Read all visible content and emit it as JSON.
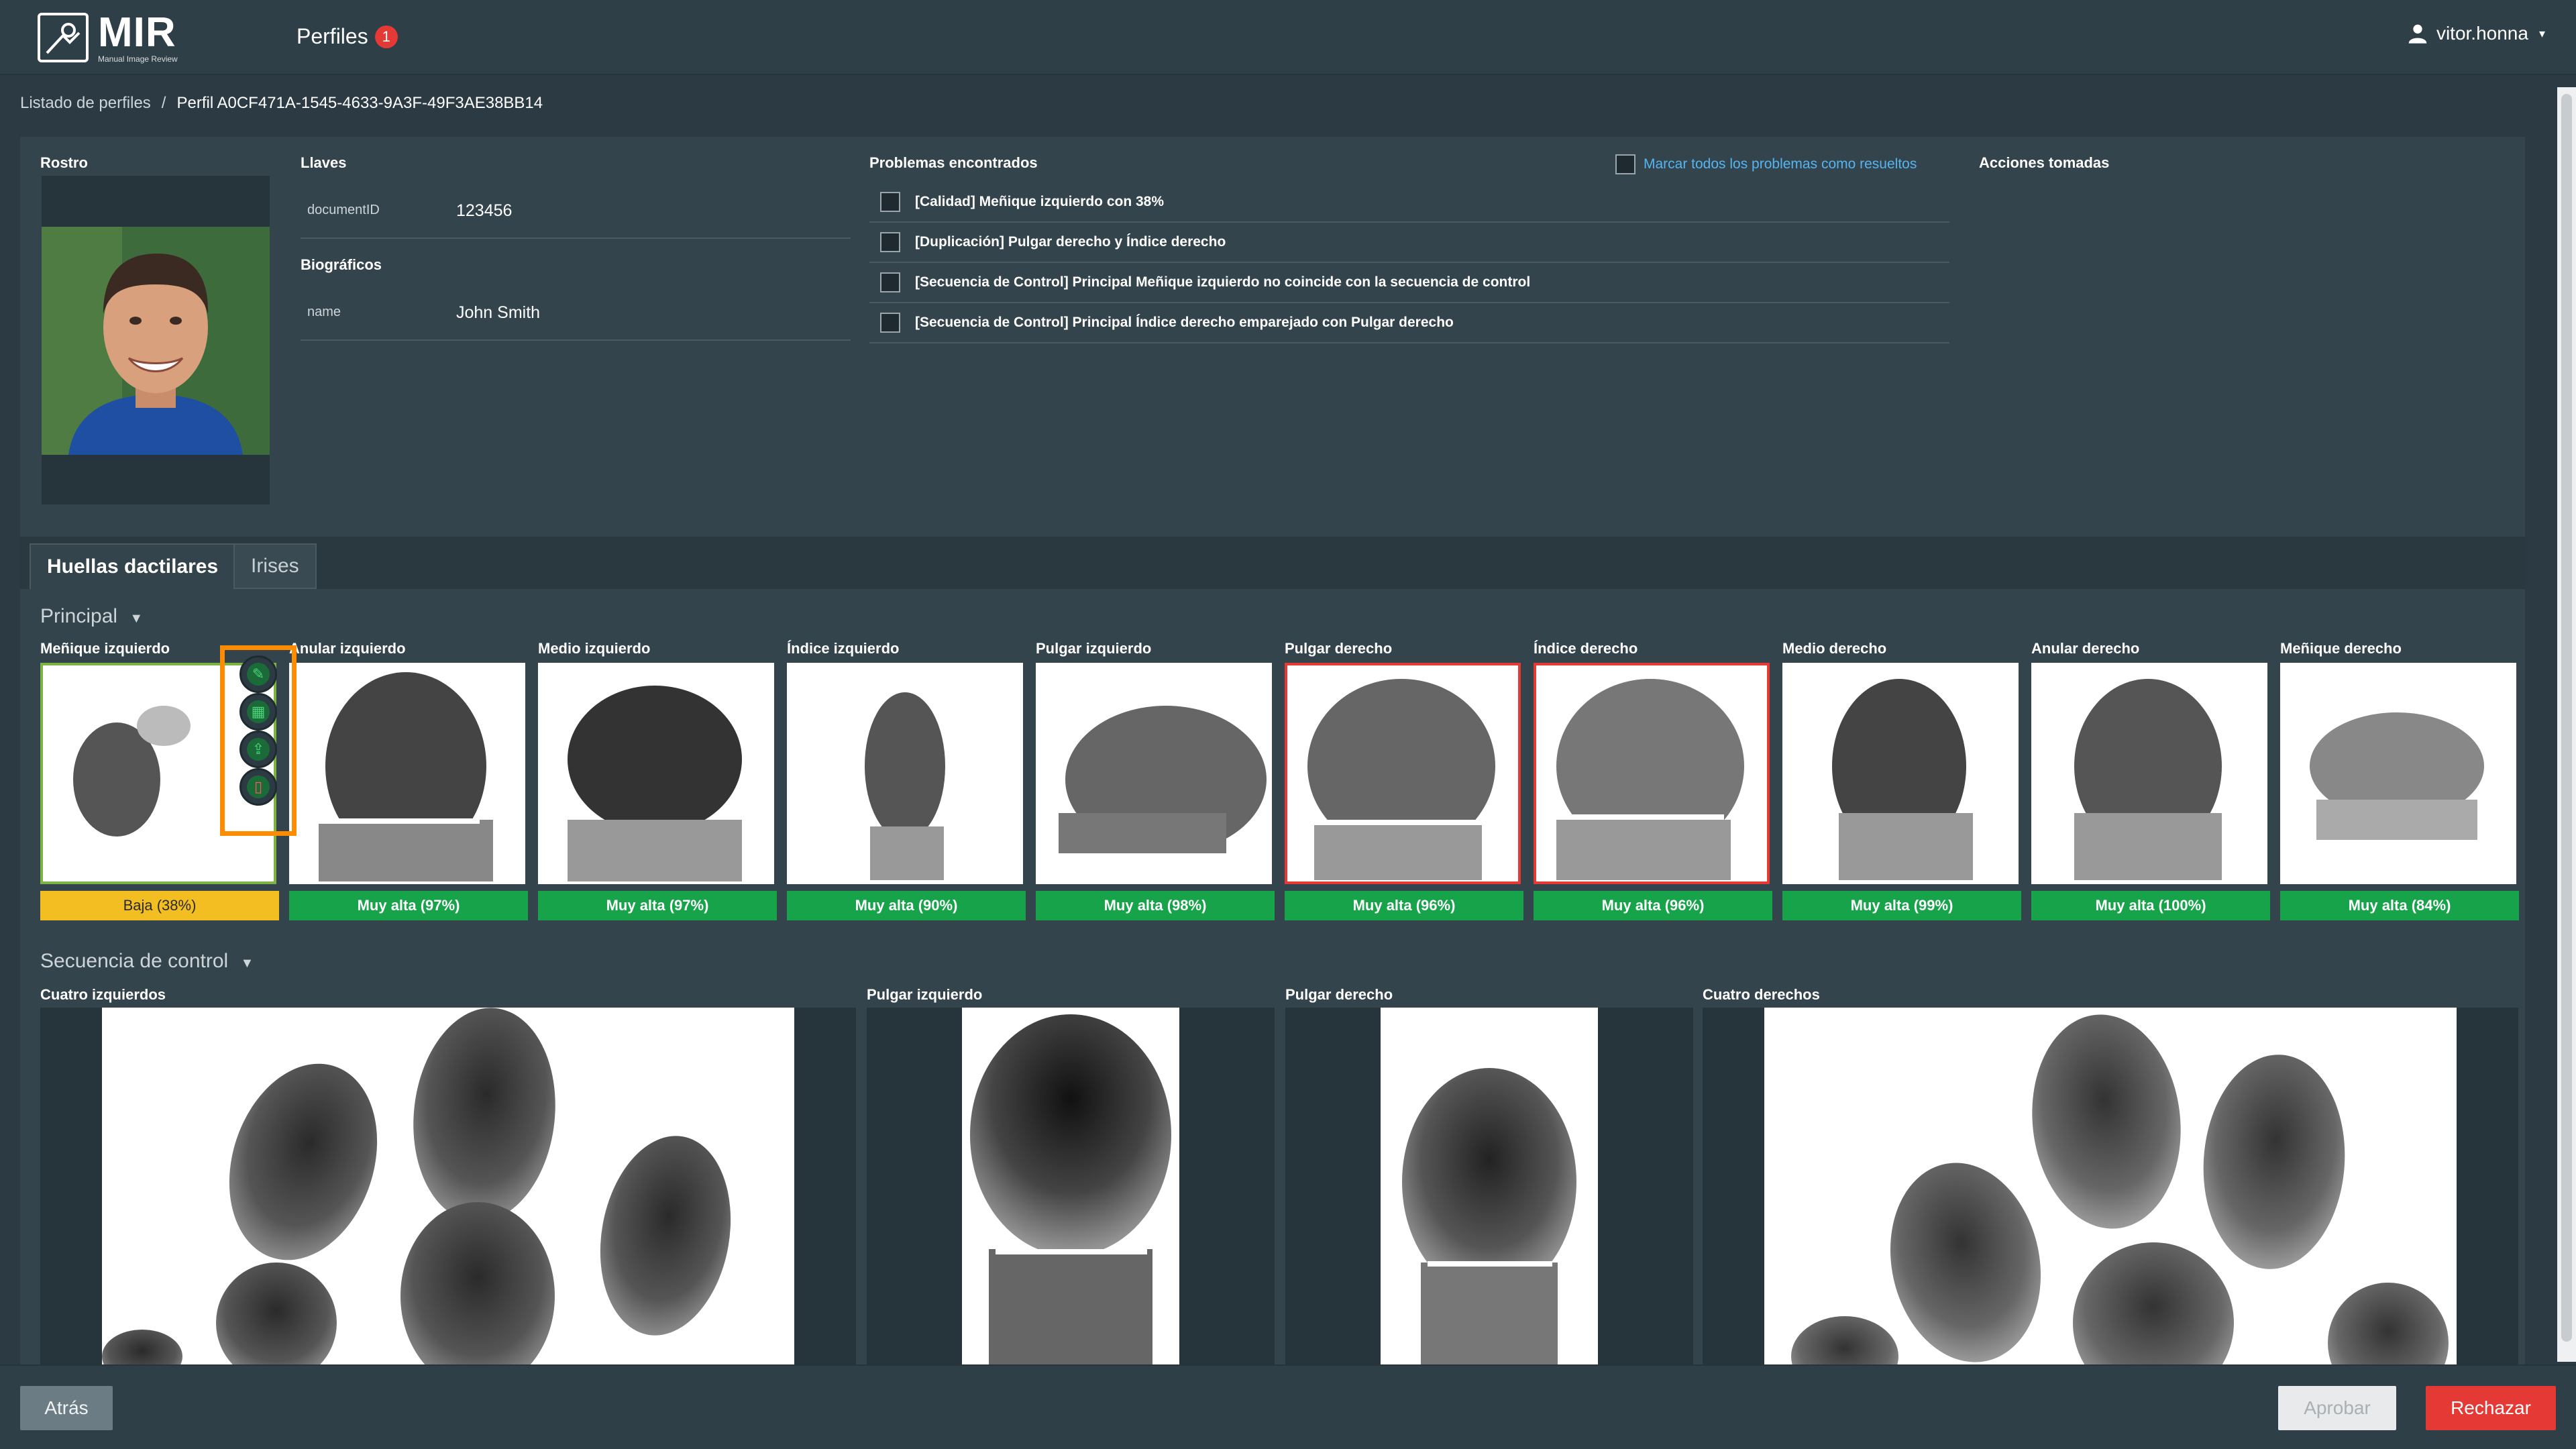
{
  "header": {
    "logo_text": "MIR",
    "logo_subtitle": "Manual Image Review",
    "nav_label": "Perfiles",
    "nav_badge": "1",
    "user_name": "vitor.honna",
    "user_caret": "▾"
  },
  "breadcrumb": {
    "parent": "Listado de perfiles",
    "separator": "/",
    "current": "Perfil A0CF471A-1545-4633-9A3F-49F3AE38BB14"
  },
  "profile": {
    "face_label": "Rostro",
    "keys_label": "Llaves",
    "keys": [
      {
        "key": "documentID",
        "value": "123456"
      }
    ],
    "bio_label": "Biográficos",
    "bio": [
      {
        "key": "name",
        "value": "John Smith"
      }
    ]
  },
  "problems": {
    "label": "Problemas encontrados",
    "mark_all": "Marcar todos los problemas como resueltos",
    "items": [
      "[Calidad] Meñique izquierdo con 38%",
      "[Duplicación] Pulgar derecho y Índice derecho",
      "[Secuencia de Control] Principal Meñique izquierdo no coincide con la secuencia de control",
      "[Secuencia de Control] Principal Índice derecho emparejado con Pulgar derecho"
    ]
  },
  "actions": {
    "label": "Acciones tomadas"
  },
  "tabs": [
    {
      "label": "Huellas dactilares",
      "active": true
    },
    {
      "label": "Irises",
      "active": false
    }
  ],
  "principal": {
    "title": "Principal",
    "caret": "▼",
    "fingers": [
      {
        "label": "Meñique izquierdo",
        "quality": "Baja (38%)",
        "level": "low",
        "state": "selected"
      },
      {
        "label": "Anular izquierdo",
        "quality": "Muy alta (97%)",
        "level": "high",
        "state": "normal"
      },
      {
        "label": "Medio izquierdo",
        "quality": "Muy alta (97%)",
        "level": "high",
        "state": "normal"
      },
      {
        "label": "Índice izquierdo",
        "quality": "Muy alta (90%)",
        "level": "high",
        "state": "normal"
      },
      {
        "label": "Pulgar izquierdo",
        "quality": "Muy alta (98%)",
        "level": "high",
        "state": "normal"
      },
      {
        "label": "Pulgar derecho",
        "quality": "Muy alta (96%)",
        "level": "high",
        "state": "error"
      },
      {
        "label": "Índice derecho",
        "quality": "Muy alta (96%)",
        "level": "high",
        "state": "error"
      },
      {
        "label": "Medio derecho",
        "quality": "Muy alta (99%)",
        "level": "high",
        "state": "normal"
      },
      {
        "label": "Anular derecho",
        "quality": "Muy alta (100%)",
        "level": "high",
        "state": "normal"
      },
      {
        "label": "Meñique derecho",
        "quality": "Muy alta (84%)",
        "level": "high",
        "state": "normal"
      }
    ],
    "tools": [
      "edit-icon",
      "replace-icon",
      "upload-icon",
      "delete-icon"
    ]
  },
  "control_sequence": {
    "title": "Secuencia de control",
    "caret": "▼",
    "items": [
      {
        "label": "Cuatro izquierdos"
      },
      {
        "label": "Pulgar izquierdo"
      },
      {
        "label": "Pulgar derecho"
      },
      {
        "label": "Cuatro derechos"
      }
    ]
  },
  "footer": {
    "back": "Atrás",
    "approve": "Aprobar",
    "reject": "Rechazar"
  },
  "colors": {
    "background": "#2c3b43",
    "accent_link": "#56b4f0",
    "quality_high": "#16a34a",
    "quality_low": "#f2be22",
    "error_border": "#e53935",
    "selected_border": "#7cb342",
    "highlight": "#ff8c00"
  }
}
